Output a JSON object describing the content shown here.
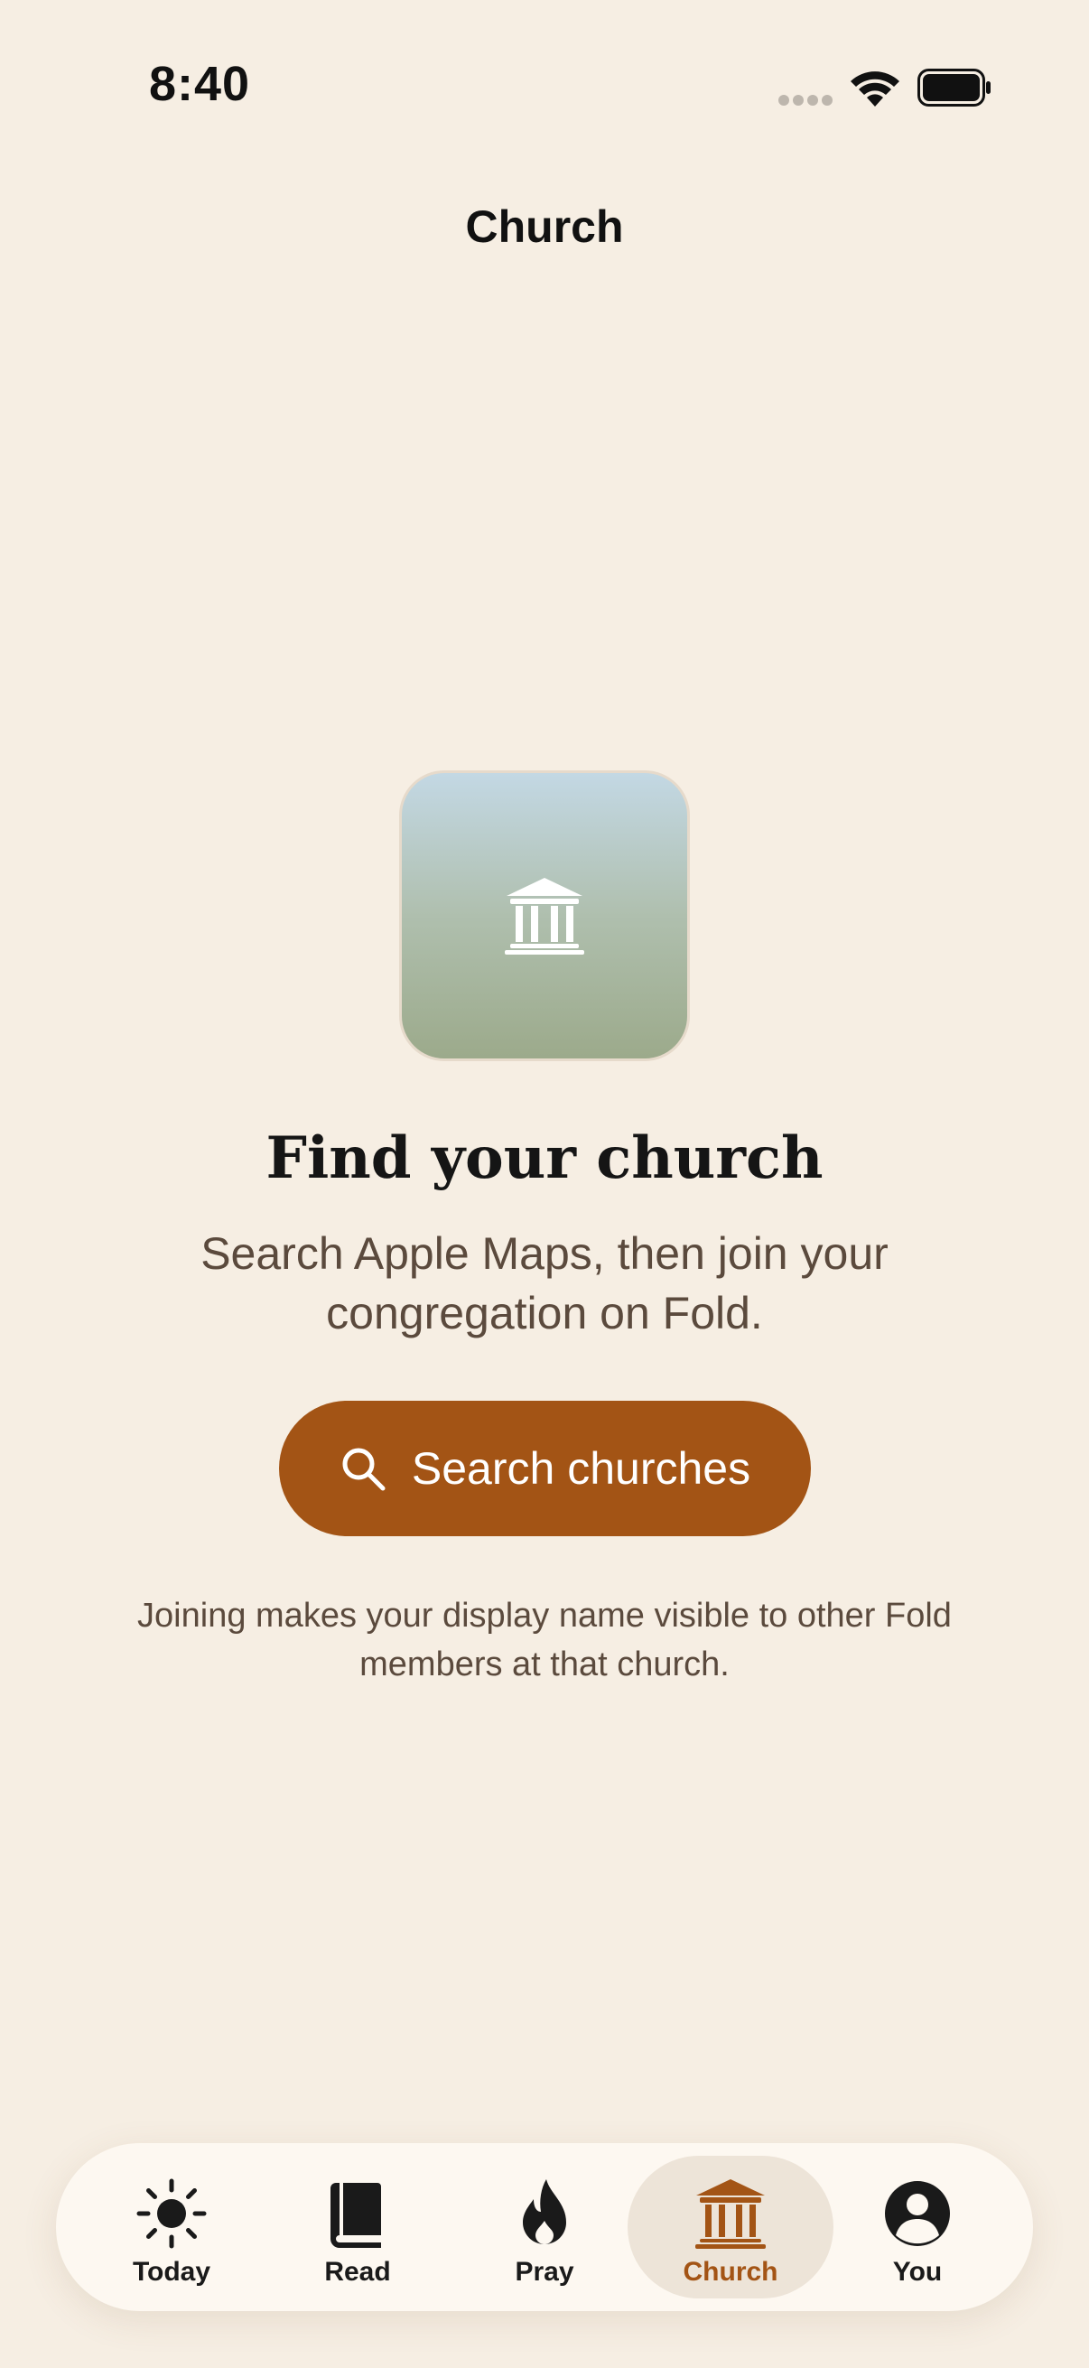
{
  "status_bar": {
    "time": "8:40"
  },
  "nav": {
    "title": "Church"
  },
  "hero": {
    "icon": "church-building-icon",
    "headline": "Find your church",
    "subtext": "Search Apple Maps, then join your congregation on Fold."
  },
  "search_button": {
    "label": "Search churches",
    "icon": "search-icon"
  },
  "footnote": "Joining makes your display name visible to other Fold members at that church.",
  "tab_bar": {
    "items": [
      {
        "label": "Today",
        "icon": "sun-icon",
        "active": false
      },
      {
        "label": "Read",
        "icon": "book-icon",
        "active": false
      },
      {
        "label": "Pray",
        "icon": "flame-icon",
        "active": false
      },
      {
        "label": "Church",
        "icon": "church-building-icon",
        "active": true
      },
      {
        "label": "You",
        "icon": "person-icon",
        "active": false
      }
    ]
  },
  "colors": {
    "background": "#F6EEE3",
    "accent": "#A35415",
    "text_secondary": "#5B4A3D",
    "tab_bar_bg": "#FDF8F1",
    "active_tab_bg": "#EDE4D8"
  }
}
